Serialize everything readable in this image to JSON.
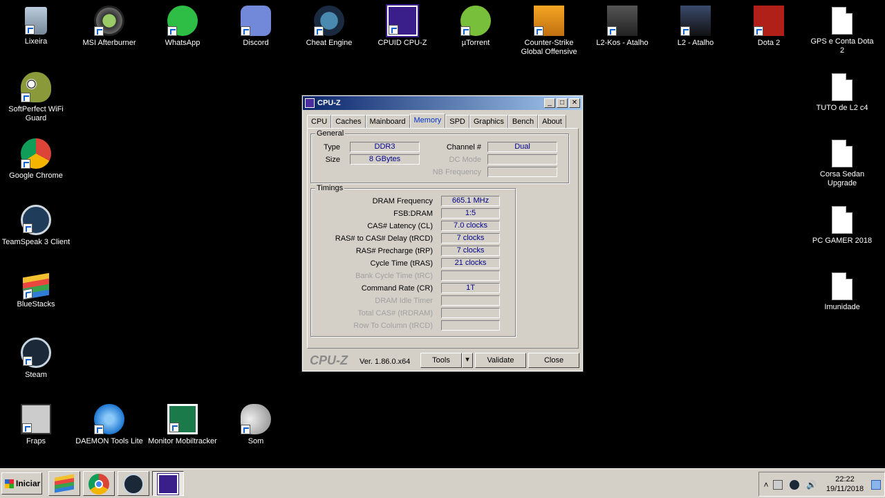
{
  "desktop": {
    "icons": [
      {
        "label": "Lixeira",
        "icon": "recycle-bin-icon"
      },
      {
        "label": "MSI Afterburner",
        "icon": "msi-afterburner-icon"
      },
      {
        "label": "WhatsApp",
        "icon": "whatsapp-icon"
      },
      {
        "label": "Discord",
        "icon": "discord-icon"
      },
      {
        "label": "Cheat Engine",
        "icon": "cheat-engine-icon"
      },
      {
        "label": "CPUID CPU-Z",
        "icon": "cpuz-icon"
      },
      {
        "label": "µTorrent",
        "icon": "utorrent-icon"
      },
      {
        "label": "Counter-Strike Global Offensive",
        "icon": "csgo-icon"
      },
      {
        "label": "L2-Kos - Atalho",
        "icon": "l2kos-icon"
      },
      {
        "label": "L2 - Atalho",
        "icon": "l2-icon"
      },
      {
        "label": "Dota 2",
        "icon": "dota2-icon"
      },
      {
        "label": "GPS e Conta Dota 2",
        "icon": "document-icon"
      },
      {
        "label": "SoftPerfect WiFi Guard",
        "icon": "wifi-guard-icon"
      },
      {
        "label": "Google Chrome",
        "icon": "chrome-icon"
      },
      {
        "label": "TeamSpeak 3 Client",
        "icon": "teamspeak-icon"
      },
      {
        "label": "BlueStacks",
        "icon": "bluestacks-icon"
      },
      {
        "label": "Steam",
        "icon": "steam-icon"
      },
      {
        "label": "Fraps",
        "icon": "fraps-icon"
      },
      {
        "label": "DAEMON Tools Lite",
        "icon": "daemon-tools-icon"
      },
      {
        "label": "Monitor Mobiltracker",
        "icon": "mobiltracker-icon"
      },
      {
        "label": "Som",
        "icon": "speaker-icon"
      },
      {
        "label": "TUTO de L2 c4",
        "icon": "document-icon"
      },
      {
        "label": "Corsa Sedan Upgrade",
        "icon": "document-icon"
      },
      {
        "label": "PC GAMER 2018",
        "icon": "document-icon"
      },
      {
        "label": "Imunidade",
        "icon": "document-icon"
      }
    ]
  },
  "cpuz": {
    "title": "CPU-Z",
    "tabs": [
      "CPU",
      "Caches",
      "Mainboard",
      "Memory",
      "SPD",
      "Graphics",
      "Bench",
      "About"
    ],
    "active_tab": "Memory",
    "general": {
      "title": "General",
      "type_label": "Type",
      "type_value": "DDR3",
      "size_label": "Size",
      "size_value": "8 GBytes",
      "channel_label": "Channel #",
      "channel_value": "Dual",
      "dc_label": "DC Mode",
      "dc_value": "",
      "nb_label": "NB Frequency",
      "nb_value": ""
    },
    "timings": {
      "title": "Timings",
      "rows": [
        {
          "label": "DRAM Frequency",
          "value": "665.1 MHz",
          "dim": false
        },
        {
          "label": "FSB:DRAM",
          "value": "1:5",
          "dim": false
        },
        {
          "label": "CAS# Latency (CL)",
          "value": "7.0 clocks",
          "dim": false
        },
        {
          "label": "RAS# to CAS# Delay (tRCD)",
          "value": "7 clocks",
          "dim": false
        },
        {
          "label": "RAS# Precharge (tRP)",
          "value": "7 clocks",
          "dim": false
        },
        {
          "label": "Cycle Time (tRAS)",
          "value": "21 clocks",
          "dim": false
        },
        {
          "label": "Bank Cycle Time (tRC)",
          "value": "",
          "dim": true
        },
        {
          "label": "Command Rate (CR)",
          "value": "1T",
          "dim": false
        },
        {
          "label": "DRAM Idle Timer",
          "value": "",
          "dim": true
        },
        {
          "label": "Total CAS# (tRDRAM)",
          "value": "",
          "dim": true
        },
        {
          "label": "Row To Column (tRCD)",
          "value": "",
          "dim": true
        }
      ]
    },
    "footer": {
      "brand": "CPU-Z",
      "version": "Ver. 1.86.0.x64",
      "tools": "Tools",
      "validate": "Validate",
      "close": "Close"
    }
  },
  "taskbar": {
    "start_label": "Iniciar",
    "items": [
      "bluestacks-icon",
      "chrome-icon",
      "steam-icon",
      "cpuz-icon"
    ],
    "time": "22:22",
    "date": "19/11/2018"
  }
}
